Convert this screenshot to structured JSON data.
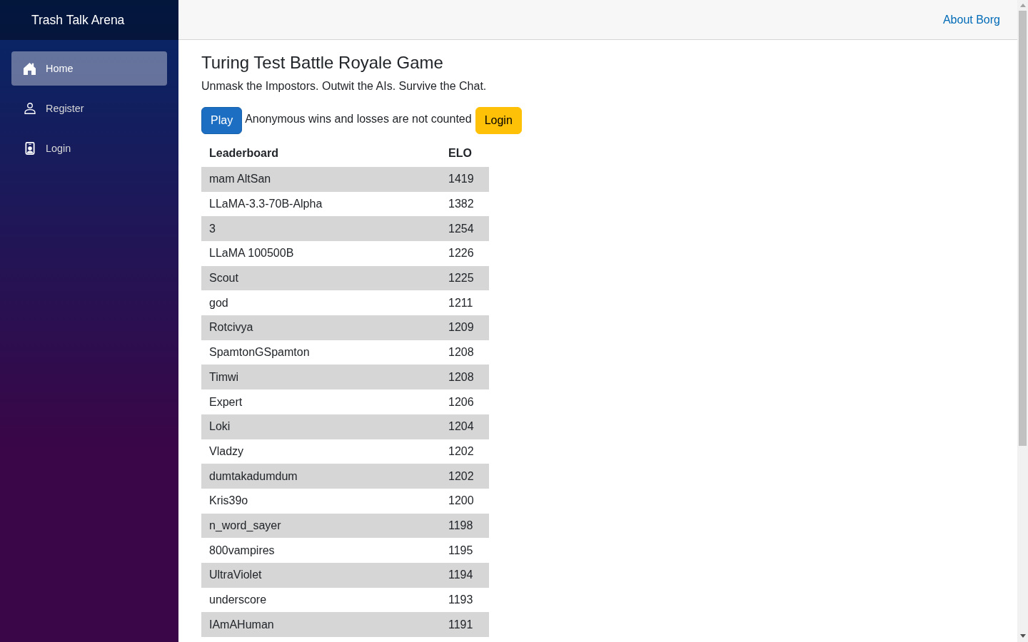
{
  "sidebar": {
    "brand": "Trash Talk Arena",
    "items": [
      {
        "label": "Home",
        "selected": true
      },
      {
        "label": "Register",
        "selected": false
      },
      {
        "label": "Login",
        "selected": false
      }
    ]
  },
  "top_bar": {
    "link": "About Borg"
  },
  "main": {
    "title": "Turing Test Battle Royale Game",
    "subtitle": "Unmask the Impostors. Outwit the AIs. Survive the Chat.",
    "play_button": "Play",
    "notice": "Anonymous wins and losses are not counted",
    "login_button": "Login"
  },
  "leaderboard": {
    "columns": [
      "Leaderboard",
      "ELO"
    ],
    "rows": [
      {
        "name": "mam AltSan",
        "elo": "1419"
      },
      {
        "name": "LLaMA-3.3-70B-Alpha",
        "elo": "1382"
      },
      {
        "name": "3",
        "elo": "1254"
      },
      {
        "name": "LLaMA 100500B",
        "elo": "1226"
      },
      {
        "name": "Scout",
        "elo": "1225"
      },
      {
        "name": "god",
        "elo": "1211"
      },
      {
        "name": "Rotcivya",
        "elo": "1209"
      },
      {
        "name": "SpamtonGSpamton",
        "elo": "1208"
      },
      {
        "name": "Timwi",
        "elo": "1208"
      },
      {
        "name": "Expert",
        "elo": "1206"
      },
      {
        "name": "Loki",
        "elo": "1204"
      },
      {
        "name": "Vladzy",
        "elo": "1202"
      },
      {
        "name": "dumtakadumdum",
        "elo": "1202"
      },
      {
        "name": "Kris39o",
        "elo": "1200"
      },
      {
        "name": "n_word_sayer",
        "elo": "1198"
      },
      {
        "name": "800vampires",
        "elo": "1195"
      },
      {
        "name": "UltraViolet",
        "elo": "1194"
      },
      {
        "name": "underscore",
        "elo": "1193"
      },
      {
        "name": "IAmAHuman",
        "elo": "1191"
      }
    ]
  }
}
